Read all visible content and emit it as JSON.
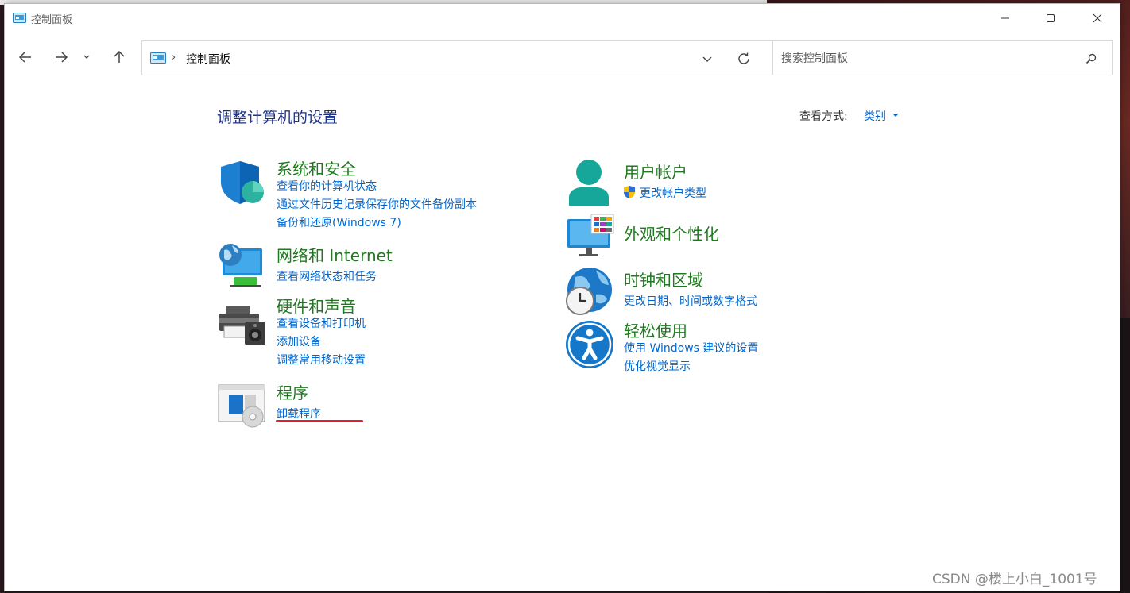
{
  "window": {
    "title": "控制面板"
  },
  "navigation": {
    "address_segment": "控制面板",
    "search_placeholder": "搜索控制面板"
  },
  "main": {
    "title": "调整计算机的设置",
    "view_by_label": "查看方式:",
    "view_by_value": "类别"
  },
  "categories": {
    "system_security": {
      "title": "系统和安全",
      "links": [
        "查看你的计算机状态",
        "通过文件历史记录保存你的文件备份副本",
        "备份和还原(Windows 7)"
      ]
    },
    "network": {
      "title": "网络和 Internet",
      "links": [
        "查看网络状态和任务"
      ]
    },
    "hardware": {
      "title": "硬件和声音",
      "links": [
        "查看设备和打印机",
        "添加设备",
        "调整常用移动设置"
      ]
    },
    "programs": {
      "title": "程序",
      "links": [
        "卸载程序"
      ]
    },
    "user_accounts": {
      "title": "用户帐户",
      "links": [
        "更改帐户类型"
      ]
    },
    "appearance": {
      "title": "外观和个性化",
      "links": []
    },
    "clock_region": {
      "title": "时钟和区域",
      "links": [
        "更改日期、时间或数字格式"
      ]
    },
    "ease_of_access": {
      "title": "轻松使用",
      "links": [
        "使用 Windows 建议的设置",
        "优化视觉显示"
      ]
    }
  },
  "watermark": "CSDN @楼上小白_1001号",
  "colors": {
    "category_title": "#1f7a1f",
    "link": "#0066cc",
    "page_title": "#1e3287",
    "highlight_underline": "#e0202c"
  },
  "icons": {
    "system_security": "shield-icon",
    "network": "globe-monitor-icon",
    "hardware": "printer-speaker-icon",
    "programs": "programs-disc-icon",
    "user_accounts": "user-icon",
    "appearance": "monitor-palette-icon",
    "clock_region": "globe-clock-icon",
    "ease_of_access": "accessibility-icon"
  }
}
